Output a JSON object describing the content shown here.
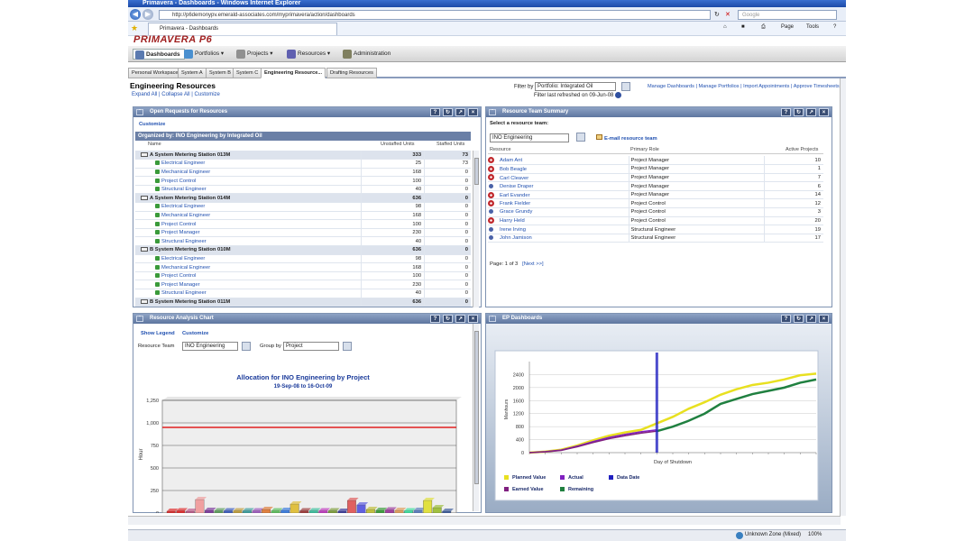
{
  "window": {
    "title": "Primavera - Dashboards - Windows Internet Explorer"
  },
  "browser": {
    "url": "http://p6demonypv.emerald-associates.com/myprimavera/action/dashboards",
    "search_placeholder": "Google",
    "tab_label": "Primavera - Dashboards",
    "page_menu": "Page",
    "tools_menu": "Tools",
    "zone": "Unknown Zone (Mixed)",
    "zoom": "100%"
  },
  "app": {
    "logo": "PRIMAVERA P6"
  },
  "menu": [
    "Dashboards",
    "Portfolios",
    "Projects",
    "Resources",
    "Administration"
  ],
  "tabs": [
    "Personal Workspace",
    "System A",
    "System B",
    "System C",
    "Engineering Resource...",
    "Drafting Resources"
  ],
  "page": {
    "title": "Engineering Resources",
    "expand_all": "Expand All",
    "collapse_all": "Collapse All",
    "customize": "Customize",
    "filter_label": "Filter by",
    "filter_value": "Portfolio: Integrated Oil",
    "last_refreshed": "Filter last refreshed on 09-Jun-08"
  },
  "top_links": [
    "Manage Dashboards",
    "Manage Portfolios",
    "Import Appointments",
    "Approve Timesheets"
  ],
  "open_requests": {
    "title": "Open Requests for Resources",
    "customize": "Customize",
    "organized": "Organized by: INO Engineering by Integrated Oil",
    "cols": [
      "Name",
      "Unstaffed Units",
      "Staffed Units"
    ],
    "rows": [
      {
        "g": true,
        "name": "A System Metering Station 013M",
        "u": "333",
        "s": "73"
      },
      {
        "name": "Electrical Engineer",
        "u": "25",
        "s": "73"
      },
      {
        "name": "Mechanical Engineer",
        "u": "168",
        "s": "0"
      },
      {
        "name": "Project Control",
        "u": "100",
        "s": "0"
      },
      {
        "name": "Structural Engineer",
        "u": "40",
        "s": "0"
      },
      {
        "g": true,
        "name": "A System Metering Station 014M",
        "u": "636",
        "s": "0"
      },
      {
        "name": "Electrical Engineer",
        "u": "98",
        "s": "0"
      },
      {
        "name": "Mechanical Engineer",
        "u": "168",
        "s": "0"
      },
      {
        "name": "Project Control",
        "u": "100",
        "s": "0"
      },
      {
        "name": "Project Manager",
        "u": "230",
        "s": "0"
      },
      {
        "name": "Structural Engineer",
        "u": "40",
        "s": "0"
      },
      {
        "g": true,
        "name": "B System Metering Station 010M",
        "u": "636",
        "s": "0"
      },
      {
        "name": "Electrical Engineer",
        "u": "98",
        "s": "0"
      },
      {
        "name": "Mechanical Engineer",
        "u": "168",
        "s": "0"
      },
      {
        "name": "Project Control",
        "u": "100",
        "s": "0"
      },
      {
        "name": "Project Manager",
        "u": "230",
        "s": "0"
      },
      {
        "name": "Structural Engineer",
        "u": "40",
        "s": "0"
      },
      {
        "g": true,
        "name": "B System Metering Station 011M",
        "u": "636",
        "s": "0"
      }
    ]
  },
  "team": {
    "title": "Resource Team Summary",
    "select_label": "Select a resource team:",
    "team_value": "INO Engineering",
    "email": "E-mail resource team",
    "cols": [
      "Resource",
      "Primary Role",
      "Active Projects"
    ],
    "rows": [
      {
        "r": "Adam Ant",
        "role": "Project Manager",
        "n": "10",
        "i": "red"
      },
      {
        "r": "Bob Beagle",
        "role": "Project Manager",
        "n": "1",
        "i": "red"
      },
      {
        "r": "Carl Cleaver",
        "role": "Project Manager",
        "n": "7",
        "i": "red"
      },
      {
        "r": "Denise Draper",
        "role": "Project Manager",
        "n": "6",
        "i": "blue"
      },
      {
        "r": "Earl Evander",
        "role": "Project Manager",
        "n": "14",
        "i": "red"
      },
      {
        "r": "Frank Fielder",
        "role": "Project Control",
        "n": "12",
        "i": "red"
      },
      {
        "r": "Grace Grundy",
        "role": "Project Control",
        "n": "3",
        "i": "blue"
      },
      {
        "r": "Harry Held",
        "role": "Project Control",
        "n": "20",
        "i": "red"
      },
      {
        "r": "Irene Irving",
        "role": "Structural Engineer",
        "n": "19",
        "i": "blue"
      },
      {
        "r": "John Jamison",
        "role": "Structural Engineer",
        "n": "17",
        "i": "blue"
      }
    ],
    "pager": "Page: 1 of 3",
    "next": "[Next >>]"
  },
  "analysis": {
    "title": "Resource Analysis Chart",
    "show_legend": "Show Legend",
    "customize": "Customize",
    "team_label": "Resource Team",
    "team_value": "INO Engineering",
    "group_label": "Group by",
    "group_value": "Project"
  },
  "ep": {
    "title": "EP Dashboards"
  },
  "chart_data": [
    {
      "type": "bar",
      "title": "Allocation for INO Engineering by Project",
      "subtitle": "19-Sep-08 to 16-Oct-09",
      "ylabel": "Hour",
      "ylim": [
        0,
        1250
      ],
      "yticks": [
        "0",
        "250",
        "500",
        "750",
        "1,000",
        "1,250"
      ],
      "limit_line": 950,
      "values": [
        20,
        25,
        20,
        150,
        30,
        25,
        25,
        25,
        25,
        25,
        40,
        25,
        30,
        100,
        25,
        25,
        25,
        25,
        20,
        140,
        90,
        40,
        30,
        35,
        30,
        25,
        30,
        140,
        60,
        20
      ],
      "colors": [
        "#e03030",
        "#e03030",
        "#c06090",
        "#f0a0a0",
        "#8040a0",
        "#60a060",
        "#4060c0",
        "#c0a040",
        "#40a0a0",
        "#a060c0",
        "#e08040",
        "#60c060",
        "#4080e0",
        "#e0c040",
        "#a04040",
        "#40c0a0",
        "#c040c0",
        "#80a040",
        "#4040a0",
        "#e06060",
        "#6060e0",
        "#c0c040",
        "#40a040",
        "#a040a0",
        "#e0a060",
        "#40e0a0",
        "#6080c0",
        "#e0e040",
        "#a0c040",
        "#4060a0"
      ]
    },
    {
      "type": "line",
      "xlabel": "Day of Shutdown",
      "ylabel": "Manhours",
      "ylim": [
        0,
        2800
      ],
      "yticks": [
        "0",
        "400",
        "800",
        "1200",
        "1600",
        "2000",
        "2400"
      ],
      "data_date_index": 8,
      "series": [
        {
          "name": "Planned Value",
          "color": "#e8e020",
          "values": [
            0,
            30,
            90,
            220,
            380,
            520,
            620,
            700,
            900,
            1100,
            1350,
            1550,
            1780,
            1950,
            2080,
            2150,
            2250,
            2380,
            2430
          ]
        },
        {
          "name": "Actual",
          "color": "#8020c0",
          "values": [
            0,
            30,
            80,
            200,
            340,
            470,
            560,
            640,
            700
          ]
        },
        {
          "name": "Earned Value",
          "color": "#802080",
          "values": [
            0,
            25,
            70,
            180,
            310,
            430,
            520,
            600,
            660
          ]
        },
        {
          "name": "Remaining",
          "color": "#208040",
          "values": [
            0,
            0,
            0,
            0,
            0,
            0,
            0,
            0,
            660,
            800,
            980,
            1200,
            1500,
            1650,
            1800,
            1900,
            2000,
            2150,
            2250
          ]
        }
      ],
      "legend": [
        "Planned Value",
        "Actual",
        "Data Date",
        "Earned Value",
        "Remaining"
      ],
      "data_date_color": "#2020c0"
    }
  ]
}
